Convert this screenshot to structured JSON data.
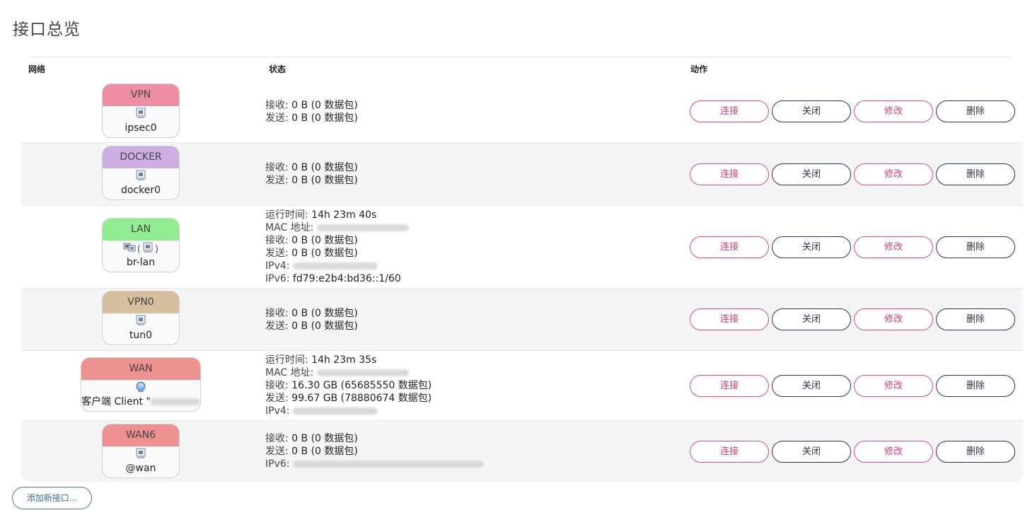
{
  "page": {
    "title": "接口总览"
  },
  "table": {
    "headers": {
      "network": "网络",
      "status": "状态",
      "actions": "动作"
    }
  },
  "colors": {
    "vpn": "#ee8ea6",
    "docker": "#cdaee3",
    "lan": "#90ee90",
    "vpn0": "#d5bf9f",
    "wan": "#ee9191",
    "wan6": "#ee9191"
  },
  "actions": {
    "connect": "连接",
    "stop": "关闭",
    "edit": "修改",
    "delete": "删除"
  },
  "interfaces": [
    {
      "name": "VPN",
      "device": "ipsec0",
      "icon": "ethernet-port-icon",
      "lines": [
        {
          "label": "接收:",
          "value": "0 B (0 数据包)"
        },
        {
          "label": "发送:",
          "value": "0 B (0 数据包)"
        }
      ]
    },
    {
      "name": "DOCKER",
      "device": "docker0",
      "icon": "ethernet-port-icon",
      "lines": [
        {
          "label": "接收:",
          "value": "0 B (0 数据包)"
        },
        {
          "label": "发送:",
          "value": "0 B (0 数据包)"
        }
      ]
    },
    {
      "name": "LAN",
      "device": "br-lan",
      "icon": "bridge-icon",
      "lines": [
        {
          "label": "运行时间:",
          "value": "14h 23m 40s"
        },
        {
          "label": "MAC 地址:",
          "value": "",
          "redacted": true
        },
        {
          "label": "接收:",
          "value": "0 B (0 数据包)"
        },
        {
          "label": "发送:",
          "value": "0 B (0 数据包)"
        },
        {
          "label": "IPv4:",
          "value": "",
          "redacted": true
        },
        {
          "label": "IPv6:",
          "value": "fd79:e2b4:bd36::1/60"
        }
      ]
    },
    {
      "name": "VPN0",
      "device": "tun0",
      "icon": "ethernet-port-icon",
      "lines": [
        {
          "label": "接收:",
          "value": "0 B (0 数据包)"
        },
        {
          "label": "发送:",
          "value": "0 B (0 数据包)"
        }
      ]
    },
    {
      "name": "WAN",
      "device": "客户端 Client \"",
      "icon": "wireless-icon",
      "lines": [
        {
          "label": "运行时间:",
          "value": "14h 23m 35s"
        },
        {
          "label": "MAC 地址:",
          "value": "",
          "redacted": true
        },
        {
          "label": "接收:",
          "value": "16.30 GB (65685550 数据包)"
        },
        {
          "label": "发送:",
          "value": "99.67 GB (78880674 数据包)"
        },
        {
          "label": "IPv4:",
          "value": "",
          "redacted": true
        }
      ]
    },
    {
      "name": "WAN6",
      "device": "@wan",
      "icon": "ethernet-port-icon",
      "lines": [
        {
          "label": "接收:",
          "value": "0 B (0 数据包)"
        },
        {
          "label": "发送:",
          "value": "0 B (0 数据包)"
        },
        {
          "label": "IPv6:",
          "value": "",
          "redacted": true
        }
      ]
    }
  ],
  "footer": {
    "add_button": "添加新接口..."
  }
}
